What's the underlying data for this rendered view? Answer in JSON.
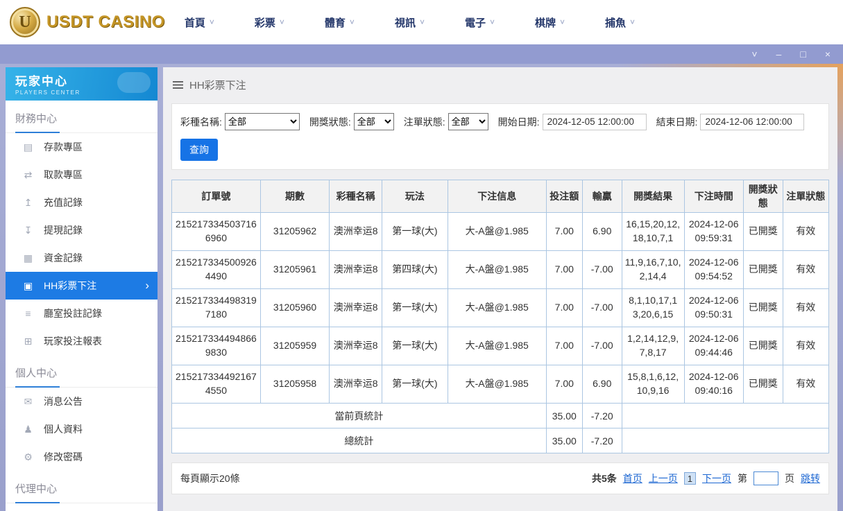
{
  "colors": {
    "accent_blue": "#1d7be4",
    "link_blue": "#1b66d2",
    "titlebar_purple": "#929bd0",
    "logo_gold": "#c49526",
    "table_border": "#abc6e2"
  },
  "icons": {
    "chevron_down": "˅",
    "chevron_right": "›",
    "minimize": "–",
    "maximize": "□",
    "close": "×"
  },
  "topnav": {
    "logo_text": "USDT CASINO",
    "logo_letter": "U",
    "items": [
      {
        "label": "首頁"
      },
      {
        "label": "彩票"
      },
      {
        "label": "體育"
      },
      {
        "label": "視訊"
      },
      {
        "label": "電子"
      },
      {
        "label": "棋牌"
      },
      {
        "label": "捕魚"
      }
    ]
  },
  "sidebar": {
    "title": "玩家中心",
    "subtitle": "PLAYERS CENTER",
    "active_item": "HH彩票下注",
    "sections": [
      {
        "title": "財務中心",
        "items": [
          {
            "label": "存款專區",
            "icon": "deposit-icon",
            "glyph": "▤"
          },
          {
            "label": "取款專區",
            "icon": "withdraw-icon",
            "glyph": "⇄"
          },
          {
            "label": "充值記錄",
            "icon": "recharge-record-icon",
            "glyph": "↥"
          },
          {
            "label": "提現記錄",
            "icon": "withdrawal-record-icon",
            "glyph": "↧"
          },
          {
            "label": "資金記錄",
            "icon": "funds-record-icon",
            "glyph": "▦"
          },
          {
            "label": "HH彩票下注",
            "icon": "lottery-bet-icon",
            "glyph": "▣"
          },
          {
            "label": "廳室投註記錄",
            "icon": "room-bet-record-icon",
            "glyph": "≡"
          },
          {
            "label": "玩家投注報表",
            "icon": "bet-report-icon",
            "glyph": "⊞"
          }
        ]
      },
      {
        "title": "個人中心",
        "items": [
          {
            "label": "消息公告",
            "icon": "announcement-icon",
            "glyph": "✉"
          },
          {
            "label": "個人資料",
            "icon": "profile-icon",
            "glyph": "♟"
          },
          {
            "label": "修改密碼",
            "icon": "password-icon",
            "glyph": "⚙"
          }
        ]
      },
      {
        "title": "代理中心",
        "items": []
      }
    ]
  },
  "breadcrumb": {
    "title": "HH彩票下注"
  },
  "filters": {
    "lottery_label": "彩種名稱:",
    "lottery_value": "全部",
    "draw_status_label": "開獎狀態:",
    "draw_status_value": "全部",
    "order_status_label": "注單狀態:",
    "order_status_value": "全部",
    "start_label": "開始日期:",
    "start_value": "2024-12-05 12:00:00",
    "end_label": "結束日期:",
    "end_value": "2024-12-06 12:00:00",
    "search_button": "查詢"
  },
  "table": {
    "headers": [
      "訂單號",
      "期數",
      "彩種名稱",
      "玩法",
      "下注信息",
      "投注額",
      "輸贏",
      "開獎結果",
      "下注時間",
      "開獎狀態",
      "注單狀態"
    ],
    "rows": [
      [
        "2152173345037166960",
        "31205962",
        "澳洲幸运8",
        "第一球(大)",
        "大-A盤@1.985",
        "7.00",
        "6.90",
        "16,15,20,12,18,10,7,1",
        "2024-12-06 09:59:31",
        "已開獎",
        "有效"
      ],
      [
        "2152173345009264490",
        "31205961",
        "澳洲幸运8",
        "第四球(大)",
        "大-A盤@1.985",
        "7.00",
        "-7.00",
        "11,9,16,7,10,2,14,4",
        "2024-12-06 09:54:52",
        "已開獎",
        "有效"
      ],
      [
        "2152173344983197180",
        "31205960",
        "澳洲幸运8",
        "第一球(大)",
        "大-A盤@1.985",
        "7.00",
        "-7.00",
        "8,1,10,17,13,20,6,15",
        "2024-12-06 09:50:31",
        "已開獎",
        "有效"
      ],
      [
        "2152173344948669830",
        "31205959",
        "澳洲幸运8",
        "第一球(大)",
        "大-A盤@1.985",
        "7.00",
        "-7.00",
        "1,2,14,12,9,7,8,17",
        "2024-12-06 09:44:46",
        "已開獎",
        "有效"
      ],
      [
        "2152173344921674550",
        "31205958",
        "澳洲幸运8",
        "第一球(大)",
        "大-A盤@1.985",
        "7.00",
        "6.90",
        "15,8,1,6,12,10,9,16",
        "2024-12-06 09:40:16",
        "已開獎",
        "有效"
      ]
    ],
    "summary": [
      {
        "label": "當前頁統計",
        "bet": "35.00",
        "winloss": "-7.20"
      },
      {
        "label": "總統計",
        "bet": "35.00",
        "winloss": "-7.20"
      }
    ]
  },
  "pagination": {
    "page_size_text": "每頁顯示20條",
    "total_text": "共5条",
    "first": "首页",
    "prev": "上一页",
    "current_page": "1",
    "next": "下一页",
    "jump_prefix": "第",
    "jump_suffix": "页",
    "jump_action": "跳转"
  }
}
